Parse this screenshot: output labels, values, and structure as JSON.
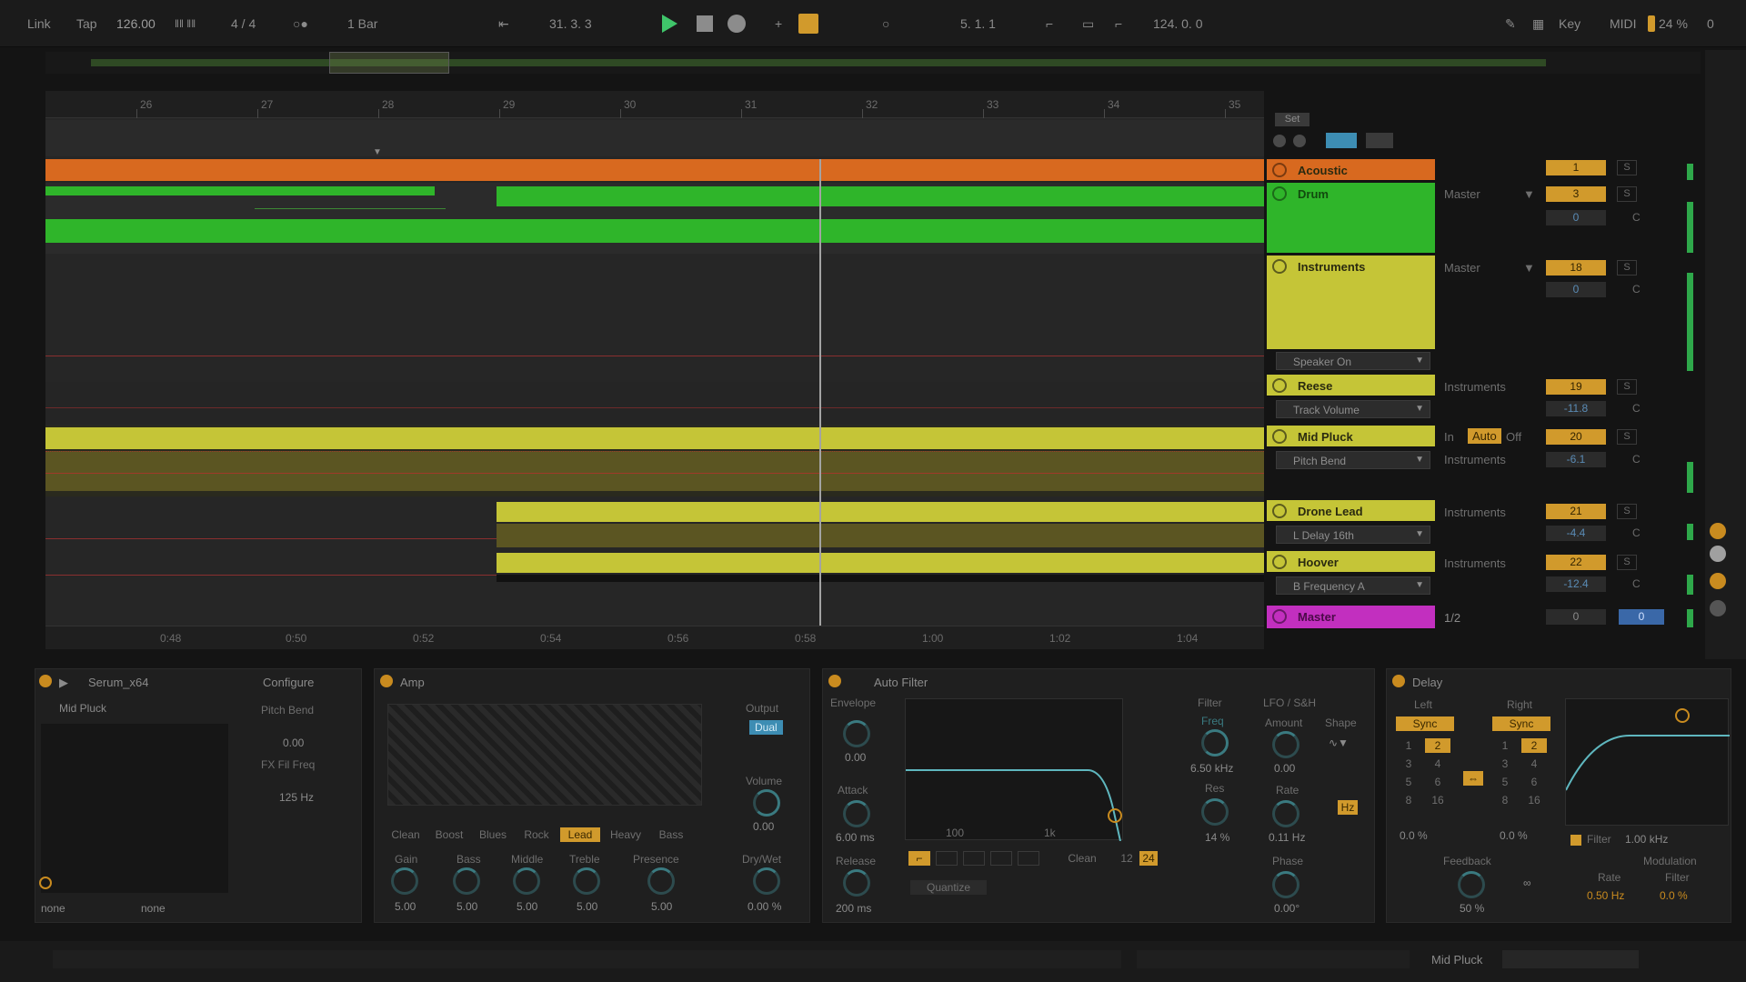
{
  "transport": {
    "link": "Link",
    "tap": "Tap",
    "tempo": "126.00",
    "signature": "4 / 4",
    "quantize": "1 Bar",
    "position": "31.  3.  3",
    "loop_start": "5.  1.  1",
    "loop_length": "124.  0.  0",
    "key_label": "Key",
    "midi_label": "MIDI",
    "cpu": "24 %",
    "cpu_value": "0"
  },
  "ruler": {
    "bars": [
      "26",
      "27",
      "28",
      "29",
      "30",
      "31",
      "32",
      "33",
      "34",
      "35"
    ],
    "times": [
      "0:48",
      "0:50",
      "0:52",
      "0:54",
      "0:56",
      "0:58",
      "1:00",
      "1:02",
      "1:04"
    ]
  },
  "header": {
    "set_label": "Set"
  },
  "tracks": [
    {
      "name": "Acoustic",
      "color": "#d8691f",
      "number": "1",
      "route": "",
      "volume": ""
    },
    {
      "name": "Drum",
      "color": "#2fb52a",
      "number": "3",
      "route": "Master",
      "volume": "0"
    },
    {
      "name": "Instruments",
      "color": "#c5c537",
      "number": "18",
      "route": "Master",
      "volume": "0"
    },
    {
      "name": "Reese",
      "color": "#c5c537",
      "number": "19",
      "route": "Instruments",
      "volume": "-11.8",
      "param": "Track Volume"
    },
    {
      "name": "Mid Pluck",
      "color": "#c5c537",
      "number": "20",
      "route": "Instruments",
      "volume": "-6.1",
      "param": "Pitch Bend"
    },
    {
      "name": "Drone Lead",
      "color": "#c5c537",
      "number": "21",
      "route": "Instruments",
      "volume": "-4.4",
      "param": "L Delay 16th"
    },
    {
      "name": "Hoover",
      "color": "#c5c537",
      "number": "22",
      "route": "Instruments",
      "volume": "-12.4",
      "param": "B Frequency A"
    },
    {
      "name": "Master",
      "color": "#c22fbf",
      "number": "0",
      "route": "1/2",
      "volume": "0"
    }
  ],
  "mixer": {
    "speaker_param": "Speaker On",
    "monitor_in": "In",
    "monitor_auto": "Auto",
    "monitor_off": "Off",
    "pan": "C",
    "solo": "S"
  },
  "devices": {
    "serum": {
      "title": "Serum_x64",
      "configure": "Configure",
      "preset": "Mid Pluck",
      "param1_label": "Pitch Bend",
      "param1_value": "0.00",
      "param2_label": "FX Fil Freq",
      "param2_value": "125 Hz",
      "in_select": "none",
      "out_select": "none"
    },
    "amp": {
      "title": "Amp",
      "output_label": "Output",
      "output_mode": "Dual",
      "volume_label": "Volume",
      "volume_value": "0.00",
      "types": [
        "Clean",
        "Boost",
        "Blues",
        "Rock",
        "Lead",
        "Heavy",
        "Bass"
      ],
      "active_type": "Lead",
      "knobs": [
        {
          "label": "Gain",
          "value": "5.00"
        },
        {
          "label": "Bass",
          "value": "5.00"
        },
        {
          "label": "Middle",
          "value": "5.00"
        },
        {
          "label": "Treble",
          "value": "5.00"
        },
        {
          "label": "Presence",
          "value": "5.00"
        }
      ],
      "drywet_label": "Dry/Wet",
      "drywet_value": "0.00 %"
    },
    "autofilter": {
      "title": "Auto Filter",
      "envelope_label": "Envelope",
      "envelope_value": "0.00",
      "attack_label": "Attack",
      "attack_value": "6.00 ms",
      "release_label": "Release",
      "release_value": "200 ms",
      "filter_label": "Filter",
      "freq_label": "Freq",
      "freq_value": "6.50 kHz",
      "res_label": "Res",
      "res_value": "14 %",
      "lfo_label": "LFO / S&H",
      "amount_label": "Amount",
      "amount_value": "0.00",
      "shape_label": "Shape",
      "rate_label": "Rate",
      "rate_value": "0.11 Hz",
      "phase_label": "Phase",
      "phase_value": "0.00°",
      "hz_label": "Hz",
      "circuit": "Clean",
      "slope_12": "12",
      "slope_24": "24",
      "quantize_label": "Quantize",
      "graph_100": "100",
      "graph_1k": "1k"
    },
    "delay": {
      "title": "Delay",
      "left_label": "Left",
      "right_label": "Right",
      "sync_label": "Sync",
      "left_values": [
        "1",
        "2",
        "3",
        "4",
        "5",
        "6",
        "8",
        "16"
      ],
      "right_values": [
        "1",
        "2",
        "3",
        "4",
        "5",
        "6",
        "8",
        "16"
      ],
      "left_offset": "0.0 %",
      "right_offset": "0.0 %",
      "feedback_label": "Feedback",
      "feedback_value": "50 %",
      "filter_label": "Filter",
      "filter_value": "1.00 kHz",
      "modulation_label": "Modulation",
      "rate_label": "Rate",
      "rate_value": "0.50 Hz",
      "mod_filter_label": "Filter",
      "mod_filter_value": "0.0 %"
    }
  },
  "status": {
    "selected_track": "Mid Pluck"
  }
}
